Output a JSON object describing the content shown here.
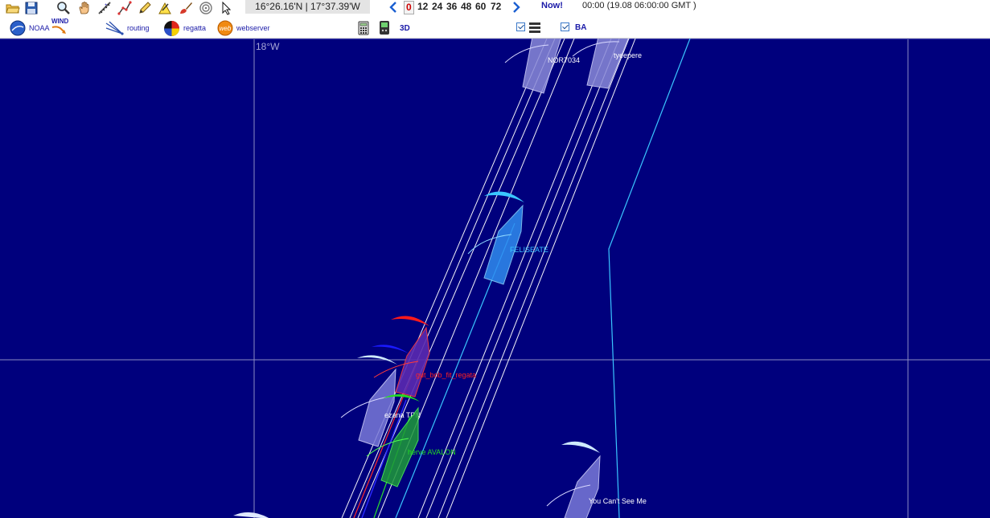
{
  "toolbar": {
    "coordinate_readout": "16°26.16'N | 17°37.39'W",
    "hours": [
      "0",
      "12",
      "24",
      "36",
      "48",
      "60",
      "72"
    ],
    "selected_hour": "0",
    "now_label": "Now!",
    "time_display": "00:00 (19.08 06:00:00 GMT )"
  },
  "modules": {
    "noaa": "NOAA",
    "wind": "WIND",
    "routing": "routing",
    "regatta": "regatta",
    "webserver": "webserver",
    "three_d": "3D",
    "ba": "BA"
  },
  "map": {
    "longitude_label": "18°W",
    "background_color": "#00007d",
    "boats": [
      {
        "name": "NOR7034",
        "color": "#ffffff"
      },
      {
        "name": "tyeepere",
        "color": "#ffffff"
      },
      {
        "name": "FELISEATE",
        "color": "#2fb8ff"
      },
      {
        "name": "gut_bob_fit_regata",
        "color": "#ff2020"
      },
      {
        "name": "ezana TPN",
        "color": "#ffffff"
      },
      {
        "name": "herve AVALON",
        "color": "#22dd22"
      },
      {
        "name": "You Can't See Me",
        "color": "#ffffff"
      }
    ]
  }
}
